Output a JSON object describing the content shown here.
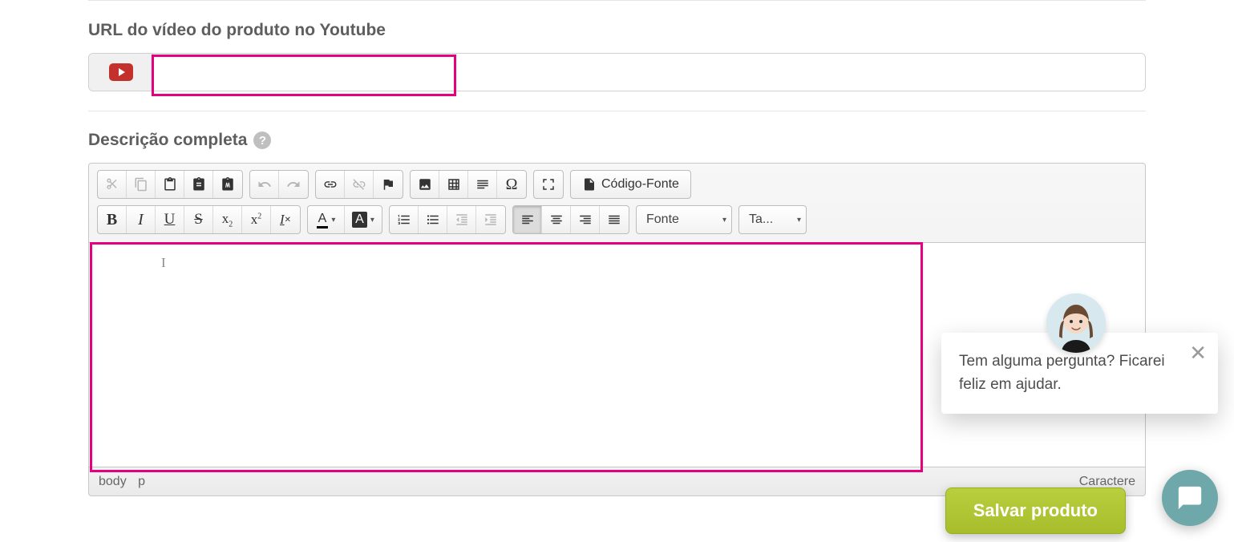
{
  "youtube": {
    "label": "URL do vídeo do produto no Youtube",
    "value": ""
  },
  "description": {
    "label": "Descrição completa",
    "help_tooltip": "?"
  },
  "toolbar": {
    "source_label": "Código-Fonte",
    "font_combo": "Fonte",
    "size_combo": "Ta...",
    "text_color_glyph": "A",
    "bg_color_glyph": "A",
    "bold": "B",
    "italic": "I",
    "underline": "U",
    "strike": "S"
  },
  "editor_footer": {
    "path_body": "body",
    "path_p": "p",
    "char_label": "Caractere"
  },
  "save_button": "Salvar produto",
  "chat": {
    "message": "Tem alguma pergunta? Ficarei feliz em ajudar.",
    "close": "✕"
  }
}
